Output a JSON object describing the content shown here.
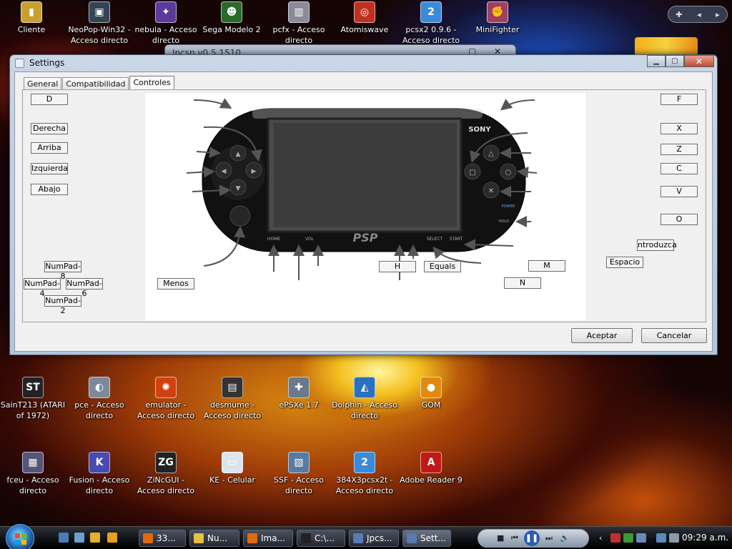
{
  "desktop_icons_top": [
    {
      "label": "Cliente",
      "color": "#c8a030",
      "glyph": "▮"
    },
    {
      "label": "NeoPop-Win32 - Acceso directo",
      "color": "#334455",
      "glyph": "▣"
    },
    {
      "label": "nebula - Acceso directo",
      "color": "#5a3a9a",
      "glyph": "✦"
    },
    {
      "label": "Sega Modelo 2",
      "color": "#2a6a2a",
      "glyph": "☻"
    },
    {
      "label": "pcfx - Acceso directo",
      "color": "#8a8a9a",
      "glyph": "▥"
    },
    {
      "label": "Atomiswave",
      "color": "#c03020",
      "glyph": "◎"
    },
    {
      "label": "pcsx2 0.9.6 - Acceso directo",
      "color": "#3a8ad8",
      "glyph": "2"
    },
    {
      "label": "MiniFighter",
      "color": "#a04060",
      "glyph": "✊"
    }
  ],
  "desktop_icons_mid": [
    {
      "label": "SainT213 (ATARI of 1972)",
      "color": "#222222",
      "glyph": "ST"
    },
    {
      "label": "pce - Acceso directo",
      "color": "#7a8a9a",
      "glyph": "◐"
    },
    {
      "label": "emulator - Acceso directo",
      "color": "#d04010",
      "glyph": "✺"
    },
    {
      "label": "desmume - Acceso directo",
      "color": "#333333",
      "glyph": "▤"
    },
    {
      "label": "ePSXe 1.7",
      "color": "#6a7a8a",
      "glyph": "✚"
    },
    {
      "label": "Dolphin - Acceso directo",
      "color": "#2a70c0",
      "glyph": "◭"
    },
    {
      "label": "GOM",
      "color": "#e08a10",
      "glyph": "●"
    }
  ],
  "desktop_icons_bottom": [
    {
      "label": "fceu - Acceso directo",
      "color": "#555577",
      "glyph": "▦"
    },
    {
      "label": "Fusion - Acceso directo",
      "color": "#4a4ab0",
      "glyph": "K"
    },
    {
      "label": "ZiNcGUI - Acceso directo",
      "color": "#222222",
      "glyph": "ZG"
    },
    {
      "label": "KE - Celular",
      "color": "#dde4ee",
      "glyph": "▭"
    },
    {
      "label": "SSF - Acceso directo",
      "color": "#5a7aa0",
      "glyph": "▧"
    },
    {
      "label": "384X3pcsx2t - Acceso directo",
      "color": "#3a8ad8",
      "glyph": "2"
    },
    {
      "label": "Adobe Reader 9",
      "color": "#c01818",
      "glyph": "A"
    }
  ],
  "bg_window": {
    "title": "Jpcsp v0.5 1510"
  },
  "window": {
    "title": "Settings",
    "tabs": [
      {
        "label": "General",
        "active": false
      },
      {
        "label": "Compatibilidad",
        "active": false
      },
      {
        "label": "Controles",
        "active": true
      }
    ],
    "keys": {
      "ltrigger": "D",
      "right": "Derecha",
      "up": "Arriba",
      "left": "Izquierda",
      "down": "Abajo",
      "analog_up": "NumPad-8",
      "analog_left": "NumPad-4",
      "analog_right": "NumPad-6",
      "analog_down": "NumPad-2",
      "home": "Menos",
      "rtrigger": "F",
      "triangle": "X",
      "square": "Z",
      "circle": "C",
      "cross": "V",
      "hold": "O",
      "start": "ntroduzca",
      "select": "Espacio",
      "music": "M",
      "screen": "N",
      "vol_plus": "Equals",
      "vol_minus": "H"
    },
    "psp_labels": {
      "sony": "SONY",
      "logo": "PSP",
      "home": "HOME",
      "vol": "VOL",
      "select": "SELECT",
      "start": "START",
      "power": "POWER",
      "hold": "HOLD"
    },
    "buttons": {
      "ok": "Aceptar",
      "cancel": "Cancelar"
    }
  },
  "taskbar": {
    "items": [
      {
        "label": "33...",
        "color": "#e06a10"
      },
      {
        "label": "Nu...",
        "color": "#e8c040"
      },
      {
        "label": "Ima...",
        "color": "#e06a10"
      },
      {
        "label": "C:\\...",
        "color": "#222222"
      },
      {
        "label": "Jpcs...",
        "color": "#5a7ab0"
      },
      {
        "label": "Sett...",
        "color": "#5a7ab0"
      }
    ],
    "clock": "09:29 a.m."
  }
}
